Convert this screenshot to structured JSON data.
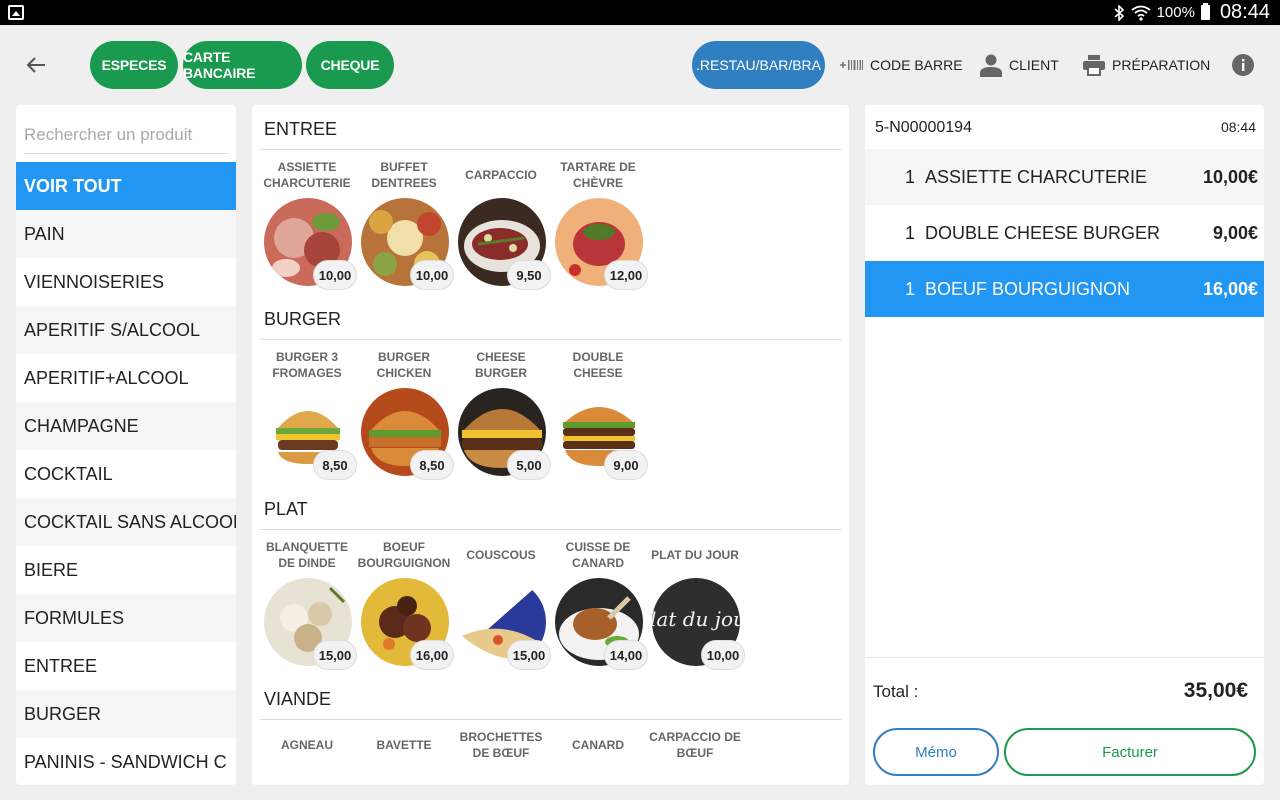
{
  "status_bar": {
    "battery": "100%",
    "time": "08:44"
  },
  "toolbar": {
    "payment_buttons": [
      "ESPECES",
      "CARTE BANCAIRE",
      "CHEQUE"
    ],
    "mode_button": ".RESTAU/BAR/BRA",
    "barcode": "CODE BARRE",
    "client": "CLIENT",
    "preparation": "PRÉPARATION"
  },
  "search": {
    "placeholder": "Rechercher un produit"
  },
  "categories": [
    "VOIR TOUT",
    "PAIN",
    "VIENNOISERIES",
    "APERITIF S/ALCOOL",
    "APERITIF+ALCOOL",
    "CHAMPAGNE",
    "COCKTAIL",
    "COCKTAIL SANS ALCOOL",
    "BIERE",
    "FORMULES",
    "ENTREE",
    "BURGER",
    "PANINIS - SANDWICH C"
  ],
  "sections": [
    {
      "title": "ENTREE",
      "products": [
        {
          "name": "ASSIETTE CHARCUTERIE",
          "price": "10,00"
        },
        {
          "name": "BUFFET DENTREES",
          "price": "10,00"
        },
        {
          "name": "CARPACCIO",
          "price": "9,50"
        },
        {
          "name": "TARTARE DE CHÈVRE",
          "price": "12,00"
        }
      ]
    },
    {
      "title": "BURGER",
      "products": [
        {
          "name": "BURGER 3 FROMAGES",
          "price": "8,50"
        },
        {
          "name": "BURGER CHICKEN",
          "price": "8,50"
        },
        {
          "name": "CHEESE BURGER",
          "price": "5,00"
        },
        {
          "name": "DOUBLE CHEESE",
          "price": "9,00"
        }
      ]
    },
    {
      "title": "PLAT",
      "products": [
        {
          "name": "BLANQUETTE DE DINDE",
          "price": "15,00"
        },
        {
          "name": "BOEUF BOURGUIGNON",
          "price": "16,00"
        },
        {
          "name": "COUSCOUS",
          "price": "15,00"
        },
        {
          "name": "CUISSE DE CANARD",
          "price": "14,00"
        },
        {
          "name": "PLAT DU JOUR",
          "price": "10,00"
        }
      ]
    },
    {
      "title": "VIANDE",
      "products": [
        {
          "name": "AGNEAU"
        },
        {
          "name": "BAVETTE"
        },
        {
          "name": "BROCHETTES DE BŒUF"
        },
        {
          "name": "CANARD"
        },
        {
          "name": "CARPACCIO DE BŒUF"
        }
      ]
    }
  ],
  "plat_du_jour_logo": "Plat du jour",
  "ticket": {
    "id": "5-N00000194",
    "time": "08:44",
    "lines": [
      {
        "qty": "1",
        "name": "ASSIETTE CHARCUTERIE",
        "amount": "10,00€"
      },
      {
        "qty": "1",
        "name": "DOUBLE CHEESE BURGER",
        "amount": "9,00€"
      },
      {
        "qty": "1",
        "name": "BOEUF BOURGUIGNON",
        "amount": "16,00€"
      }
    ],
    "total_label": "Total :",
    "total": "35,00€",
    "memo": "Mémo",
    "invoice": "Facturer"
  },
  "colors": {
    "green": "#1a9a4f",
    "blue": "#2f7fc1",
    "selected": "#2196f3"
  }
}
